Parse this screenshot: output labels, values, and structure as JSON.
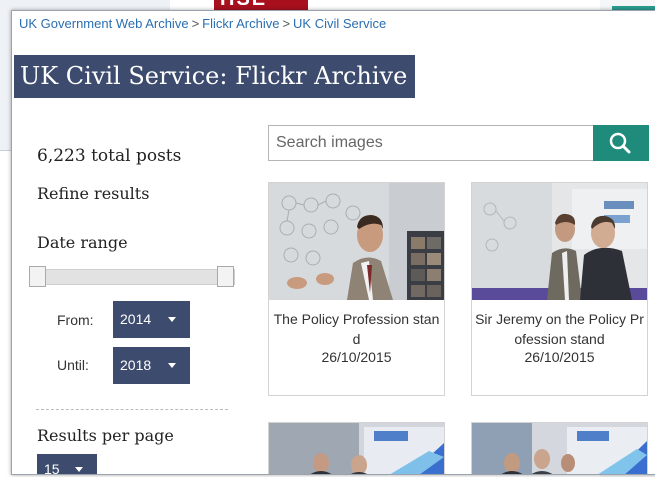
{
  "background": {
    "logo_text": "HSE"
  },
  "breadcrumb": {
    "items": [
      "UK Government Web Archive",
      "Flickr Archive",
      "UK Civil Service"
    ],
    "separator": ">"
  },
  "page_title": "UK Civil Service: Flickr Archive",
  "sidebar": {
    "total_posts": "6,223 total posts",
    "refine_label": "Refine results",
    "date_range_label": "Date range",
    "from_label": "From:",
    "from_value": "2014",
    "until_label": "Until:",
    "until_value": "2018",
    "results_per_page_label": "Results per page",
    "results_per_page_value": "15"
  },
  "search": {
    "placeholder": "Search images",
    "icon": "search-icon"
  },
  "cards": [
    {
      "caption": "The Policy Profession stand",
      "date": "26/10/2015"
    },
    {
      "caption": "Sir Jeremy on the Policy Profession stand",
      "date": "26/10/2015"
    },
    {
      "caption": "",
      "date": ""
    },
    {
      "caption": "",
      "date": ""
    }
  ],
  "colors": {
    "title_bg": "#3d4b6e",
    "select_bg": "#3d4b6e",
    "search_button": "#1f8b7a",
    "link": "#2a6fb0"
  }
}
